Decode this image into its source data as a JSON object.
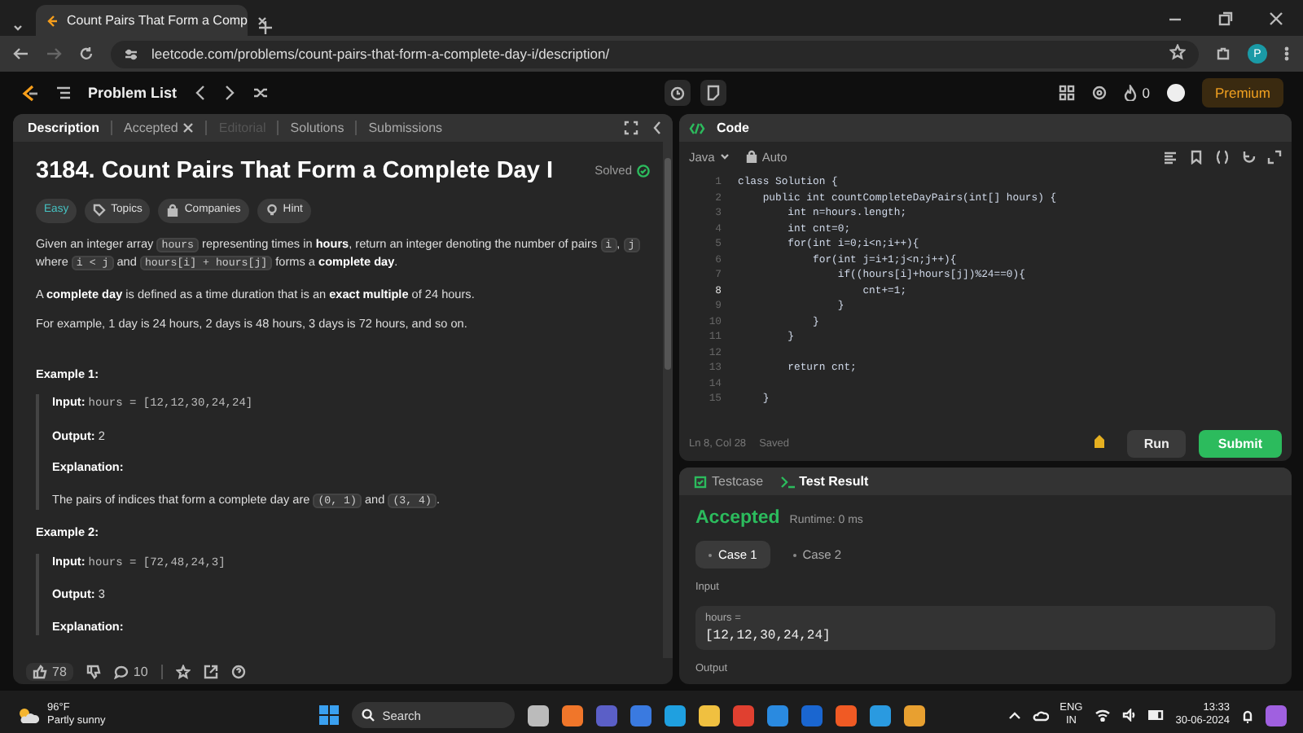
{
  "browser": {
    "tab_title": "Count Pairs That Form a Comp",
    "url": "leetcode.com/problems/count-pairs-that-form-a-complete-day-i/description/",
    "profile": "P"
  },
  "header": {
    "problem_list": "Problem List",
    "streak": "0",
    "premium": "Premium"
  },
  "left_tabs": [
    {
      "label": "Description",
      "selected": true,
      "disabled": false,
      "closable": false
    },
    {
      "label": "Accepted",
      "selected": false,
      "disabled": false,
      "closable": true
    },
    {
      "label": "Editorial",
      "selected": false,
      "disabled": true,
      "closable": false
    },
    {
      "label": "Solutions",
      "selected": false,
      "disabled": false,
      "closable": false
    },
    {
      "label": "Submissions",
      "selected": false,
      "disabled": false,
      "closable": false
    }
  ],
  "problem": {
    "title": "3184. Count Pairs That Form a Complete Day I",
    "status": "Solved",
    "tags": [
      {
        "label": "Easy",
        "kind": "difficulty"
      },
      {
        "label": "Topics",
        "kind": "topics"
      },
      {
        "label": "Companies",
        "kind": "companies"
      },
      {
        "label": "Hint",
        "kind": "hint"
      }
    ],
    "paragraphs": [
      [
        {
          "kind": "text",
          "text": "Given an integer array "
        },
        {
          "kind": "code",
          "text": "hours"
        },
        {
          "kind": "text",
          "text": " representing times in "
        },
        {
          "kind": "bold",
          "text": "hours"
        },
        {
          "kind": "text",
          "text": ", return an integer denoting the number of pairs "
        },
        {
          "kind": "code",
          "text": "i"
        },
        {
          "kind": "text",
          "text": ", "
        },
        {
          "kind": "code",
          "text": "j"
        },
        {
          "kind": "text",
          "text": " where "
        },
        {
          "kind": "code",
          "text": "i < j"
        },
        {
          "kind": "text",
          "text": " and "
        },
        {
          "kind": "code",
          "text": "hours[i] + hours[j]"
        },
        {
          "kind": "text",
          "text": " forms a "
        },
        {
          "kind": "bold",
          "text": "complete day"
        },
        {
          "kind": "text",
          "text": "."
        }
      ],
      [
        {
          "kind": "text",
          "text": "A "
        },
        {
          "kind": "bold",
          "text": "complete day"
        },
        {
          "kind": "text",
          "text": " is defined as a time duration that is an "
        },
        {
          "kind": "bold",
          "text": "exact multiple"
        },
        {
          "kind": "text",
          "text": " of 24 hours."
        }
      ],
      [
        {
          "kind": "text",
          "text": "For example, 1 day is 24 hours, 2 days is 48 hours, 3 days is 72 hours, and so on."
        }
      ]
    ],
    "examples": [
      {
        "heading": "Example 1:",
        "input_label": "Input:",
        "input": "hours = [12,12,30,24,24]",
        "output_label": "Output:",
        "output": "2",
        "explanation_label": "Explanation:",
        "explanation": [
          {
            "kind": "text",
            "text": "The pairs of indices that form a complete day are "
          },
          {
            "kind": "code",
            "text": "(0, 1)"
          },
          {
            "kind": "text",
            "text": " and "
          },
          {
            "kind": "code",
            "text": "(3, 4)"
          },
          {
            "kind": "text",
            "text": "."
          }
        ]
      },
      {
        "heading": "Example 2:",
        "input_label": "Input:",
        "input": "hours = [72,48,24,3]",
        "output_label": "Output:",
        "output": "3",
        "explanation_label": "Explanation:"
      }
    ]
  },
  "footer": {
    "likes": "78",
    "comments": "10"
  },
  "editor": {
    "title": "Code",
    "language": "Java",
    "mode": "Auto",
    "lines": [
      {
        "number": "1",
        "code": "class Solution {",
        "current": false
      },
      {
        "number": "2",
        "code": "    public int countCompleteDayPairs(int[] hours) {",
        "current": false
      },
      {
        "number": "3",
        "code": "        int n=hours.length;",
        "current": false
      },
      {
        "number": "4",
        "code": "        int cnt=0;",
        "current": false
      },
      {
        "number": "5",
        "code": "        for(int i=0;i<n;i++){",
        "current": false
      },
      {
        "number": "6",
        "code": "            for(int j=i+1;j<n;j++){",
        "current": false
      },
      {
        "number": "7",
        "code": "                if((hours[i]+hours[j])%24==0){",
        "current": false
      },
      {
        "number": "8",
        "code": "                    cnt+=1;",
        "current": true
      },
      {
        "number": "9",
        "code": "                }",
        "current": false
      },
      {
        "number": "10",
        "code": "            }",
        "current": false
      },
      {
        "number": "11",
        "code": "        }",
        "current": false
      },
      {
        "number": "12",
        "current": false
      },
      {
        "number": "13",
        "code": "        return cnt;",
        "current": false
      },
      {
        "number": "14",
        "current": false
      },
      {
        "number": "15",
        "code": "    }",
        "current": false
      }
    ],
    "cursor": "Ln 8, Col 28",
    "save_state": "Saved",
    "run": "Run",
    "submit": "Submit"
  },
  "results": {
    "tabs": [
      {
        "label": "Testcase",
        "selected": false
      },
      {
        "label": "Test Result",
        "selected": true
      }
    ],
    "verdict": "Accepted",
    "runtime": "Runtime: 0 ms",
    "cases": [
      {
        "label": "Case 1",
        "selected": true
      },
      {
        "label": "Case 2",
        "selected": false
      }
    ],
    "input_label": "Input",
    "var_name": "hours =",
    "var_value": "[12,12,30,24,24]",
    "output_label": "Output"
  },
  "taskbar": {
    "temperature": "96°F",
    "weather": "Partly sunny",
    "search": "Search",
    "lang": "ENG",
    "region": "IN",
    "time": "13:33",
    "date": "30-06-2024"
  }
}
